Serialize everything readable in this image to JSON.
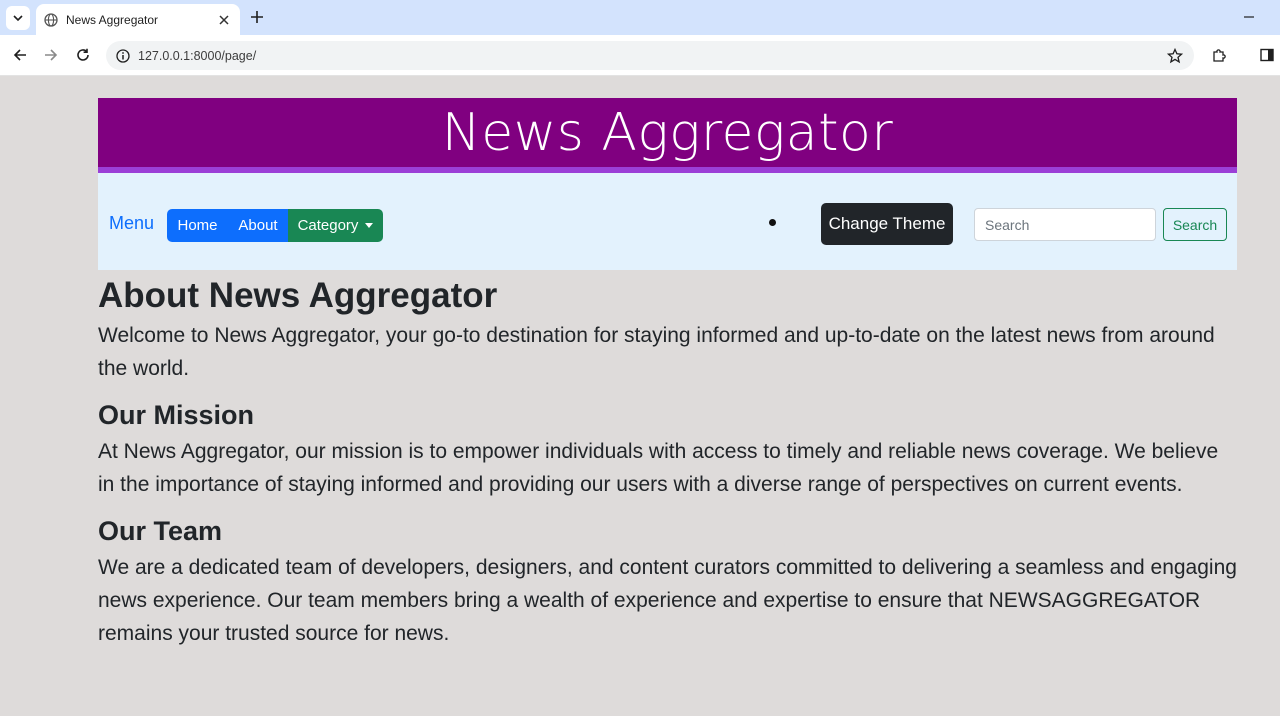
{
  "browser": {
    "tab_title": "News Aggregator",
    "url": "127.0.0.1:8000/page/"
  },
  "header": {
    "site_title": "News Aggregator"
  },
  "navbar": {
    "menu_label": "Menu",
    "home_label": "Home",
    "about_label": "About",
    "category_label": "Category",
    "theme_button_label": "Change Theme",
    "search_placeholder": "Search",
    "search_button_label": "Search"
  },
  "content": {
    "title": "About News Aggregator",
    "intro": "Welcome to News Aggregator, your go-to destination for staying informed and up-to-date on the latest news from around the world.",
    "mission_heading": "Our Mission",
    "mission_text": "At News Aggregator, our mission is to empower individuals with access to timely and reliable news coverage. We believe in the importance of staying informed and providing our users with a diverse range of perspectives on current events.",
    "team_heading": "Our Team",
    "team_text": "We are a dedicated team of developers, designers, and content curators committed to delivering a seamless and engaging news experience. Our team members bring a wealth of experience and expertise to ensure that NEWSAGGREGATOR remains your trusted source for news."
  },
  "colors": {
    "header_bg": "#800080",
    "header_border": "#9b3fd7",
    "navbar_bg": "#e3f2fd",
    "primary": "#0d6efd",
    "success": "#198754",
    "dark": "#212529",
    "page_bg": "#dedbda"
  }
}
